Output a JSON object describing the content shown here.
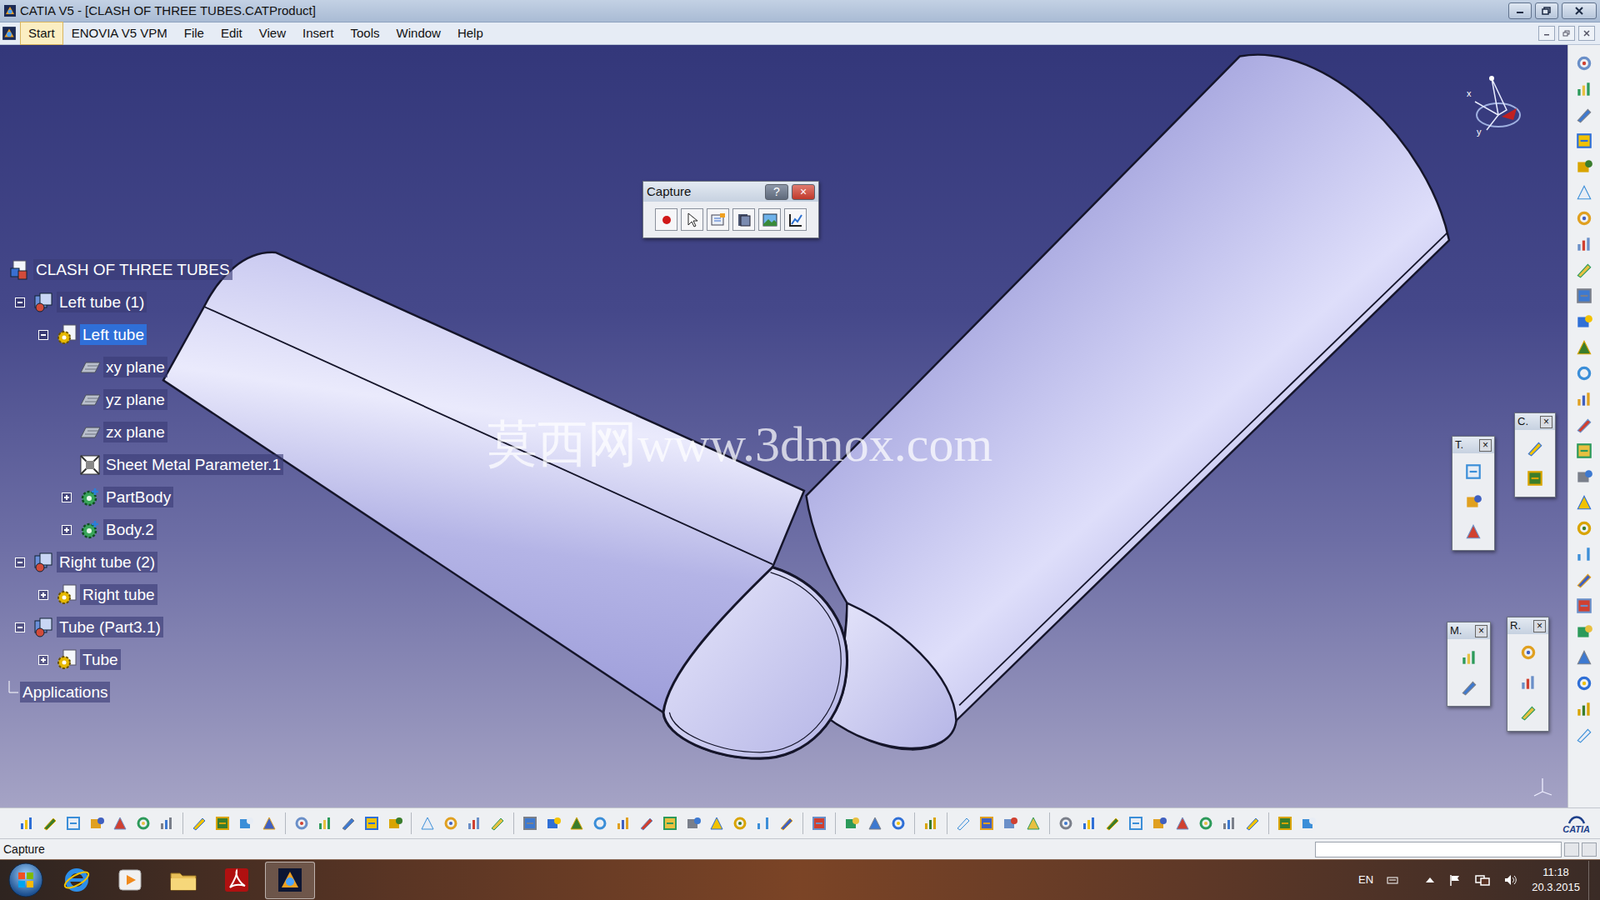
{
  "window": {
    "title": "CATIA V5 - [CLASH OF THREE TUBES.CATProduct]"
  },
  "menu": [
    {
      "label": "Start",
      "selected": true
    },
    {
      "label": "ENOVIA V5 VPM",
      "selected": false
    },
    {
      "label": "File",
      "selected": false
    },
    {
      "label": "Edit",
      "selected": false
    },
    {
      "label": "View",
      "selected": false
    },
    {
      "label": "Insert",
      "selected": false
    },
    {
      "label": "Tools",
      "selected": false
    },
    {
      "label": "Window",
      "selected": false
    },
    {
      "label": "Help",
      "selected": false
    }
  ],
  "tree": [
    {
      "label": "CLASH OF THREE TUBES",
      "depth": 0,
      "kind": "product",
      "expandable": false,
      "expanded": true,
      "selected": false
    },
    {
      "label": "Left tube (1)",
      "depth": 1,
      "kind": "component",
      "expandable": true,
      "expanded": true,
      "selected": false
    },
    {
      "label": "Left tube",
      "depth": 2,
      "kind": "part",
      "expandable": true,
      "expanded": true,
      "selected": true
    },
    {
      "label": "xy plane",
      "depth": 3,
      "kind": "plane",
      "expandable": false,
      "expanded": false,
      "selected": false
    },
    {
      "label": "yz plane",
      "depth": 3,
      "kind": "plane",
      "expandable": false,
      "expanded": false,
      "selected": false
    },
    {
      "label": "zx plane",
      "depth": 3,
      "kind": "plane",
      "expandable": false,
      "expanded": false,
      "selected": false
    },
    {
      "label": "Sheet Metal Parameter.1",
      "depth": 3,
      "kind": "parameter",
      "expandable": false,
      "expanded": false,
      "selected": false
    },
    {
      "label": "PartBody",
      "depth": 3,
      "kind": "body",
      "expandable": true,
      "expanded": false,
      "selected": false
    },
    {
      "label": "Body.2",
      "depth": 3,
      "kind": "body",
      "expandable": true,
      "expanded": false,
      "selected": false
    },
    {
      "label": "Right tube (2)",
      "depth": 1,
      "kind": "component",
      "expandable": true,
      "expanded": true,
      "selected": false
    },
    {
      "label": "Right tube",
      "depth": 2,
      "kind": "part",
      "expandable": true,
      "expanded": false,
      "selected": false
    },
    {
      "label": "Tube (Part3.1)",
      "depth": 1,
      "kind": "component",
      "expandable": true,
      "expanded": true,
      "selected": false
    },
    {
      "label": "Tube",
      "depth": 2,
      "kind": "part",
      "expandable": true,
      "expanded": false,
      "selected": false
    },
    {
      "label": "Applications",
      "depth": 0,
      "kind": "applications",
      "expandable": false,
      "expanded": false,
      "selected": false
    }
  ],
  "capture_toolbar": {
    "title": "Capture",
    "help": "?",
    "close": "×"
  },
  "mini_toolbars": [
    {
      "title": "T.",
      "close": "×"
    },
    {
      "title": "C.",
      "close": "×"
    },
    {
      "title": "M.",
      "close": "×"
    },
    {
      "title": "R.",
      "close": "×"
    }
  ],
  "compass": {
    "x": "x",
    "y": "y"
  },
  "watermark": "莫西网www.3dmox.com",
  "toolbar_brand": "CATIA",
  "status_bar": {
    "text": "Capture"
  },
  "taskbar": {
    "apps": [
      {
        "kind": "ie",
        "selected": false
      },
      {
        "kind": "media",
        "selected": false
      },
      {
        "kind": "explorer",
        "selected": false
      },
      {
        "kind": "acrobat",
        "selected": false
      },
      {
        "kind": "catia",
        "selected": true
      }
    ],
    "language": "EN",
    "time": "11:18",
    "date": "20.3.2015"
  }
}
